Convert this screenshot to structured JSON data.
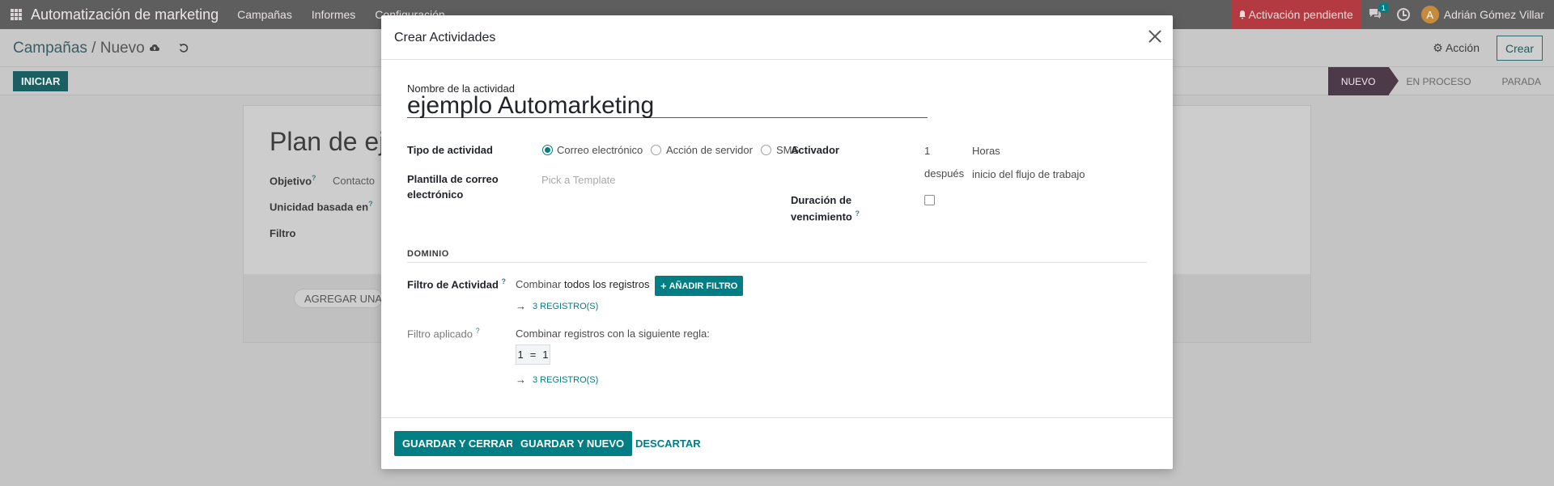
{
  "navbar": {
    "brand": "Automatización de marketing",
    "menu": [
      "Campañas",
      "Informes",
      "Configuración"
    ],
    "alert_label": "Activación pendiente",
    "chat_badge": "1",
    "user_initial": "A",
    "user_name": "Adrián Gómez Villar"
  },
  "control": {
    "breadcrumb_parent": "Campañas",
    "breadcrumb_sep": "/",
    "breadcrumb_current": "Nuevo",
    "accion_label": "Acción",
    "crear_label": "Crear",
    "iniciar_label": "INICIAR",
    "stages": [
      "NUEVO",
      "EN PROCESO",
      "PARADA"
    ]
  },
  "sheet": {
    "title": "Plan de eje",
    "objetivo_label": "Objetivo",
    "objetivo_value": "Contacto",
    "unicidad_label": "Unicidad basada en",
    "filtro_label": "Filtro",
    "agregar_label": "AGREGAR UNA N"
  },
  "modal": {
    "title": "Crear Actividades",
    "name_label": "Nombre de la actividad",
    "name_value": "ejemplo Automarketing",
    "tipo_label": "Tipo de actividad",
    "tipo_options": [
      "Correo electrónico",
      "Acción de servidor",
      "SMS"
    ],
    "tipo_selected": "Correo electrónico",
    "plantilla_label_1": "Plantilla de correo",
    "plantilla_label_2": "electrónico",
    "plantilla_placeholder": "Pick a Template",
    "activador_label": "Activador",
    "interval_number": "1",
    "interval_unit": "Horas",
    "trigger_when": "después",
    "trigger_type": "inicio del flujo de trabajo",
    "duracion_label_1": "Duración de",
    "duracion_label_2": "vencimiento",
    "help_mark": "?",
    "dominio_title": "DOMINIO",
    "filtro_actividad_label": "Filtro de Actividad",
    "combinar_prefix": "Combinar",
    "combinar_rest": "todos los registros",
    "anadir_filtro_label": "AÑADIR FILTRO",
    "registros_1": "3 REGISTRO(S)",
    "filtro_aplicado_label": "Filtro aplicado",
    "combinar_regla": "Combinar registros con la siguiente regla:",
    "rule_left": "1",
    "rule_op": "=",
    "rule_right": "1",
    "registros_2": "3 REGISTRO(S)"
  },
  "footer": {
    "guardar_cerrar": "GUARDAR Y CERRAR",
    "guardar_nuevo": "GUARDAR Y NUEVO",
    "descartar": "DESCARTAR"
  },
  "colors": {
    "primary": "#017e84",
    "navbar": "#5f5e5f",
    "alert": "#b23a40",
    "stage_active": "#4d3a49"
  }
}
